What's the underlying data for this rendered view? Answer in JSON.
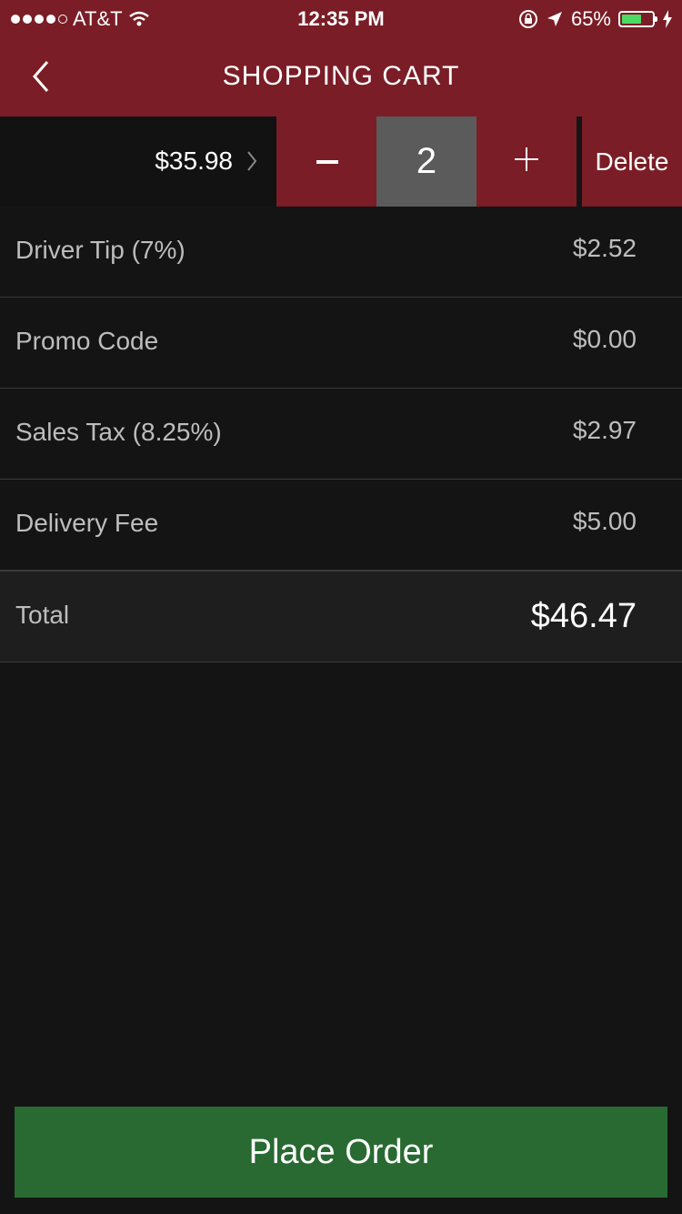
{
  "status_bar": {
    "carrier": "AT&T",
    "time": "12:35 PM",
    "battery_percent": "65%",
    "battery_level": 0.65
  },
  "nav": {
    "title": "SHOPPING CART"
  },
  "cart_item": {
    "price": "$35.98",
    "quantity": "2",
    "delete_label": "Delete"
  },
  "summary": [
    {
      "label": "Driver Tip (7%)",
      "value": "$2.52"
    },
    {
      "label": "Promo Code",
      "value": "$0.00"
    },
    {
      "label": "Sales Tax (8.25%)",
      "value": "$2.97"
    },
    {
      "label": "Delivery Fee",
      "value": "$5.00"
    }
  ],
  "total": {
    "label": "Total",
    "value": "$46.47"
  },
  "place_order_label": "Place Order",
  "colors": {
    "header_maroon": "#7a1d26",
    "background": "#141414",
    "place_order_green": "#286a32",
    "qty_gray": "#5b5b5b"
  }
}
